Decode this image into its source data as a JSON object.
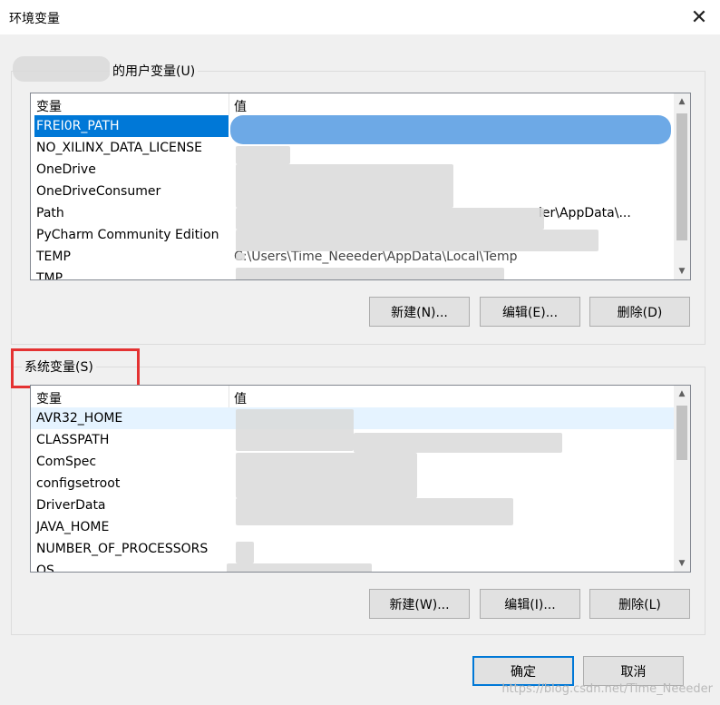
{
  "window": {
    "title": "环境变量",
    "close_icon": "close-icon"
  },
  "user_vars": {
    "group_title": "的用户变量(U)",
    "col_name": "变量",
    "col_value": "值",
    "rows": [
      {
        "name": "FREI0R_PATH",
        "value": ""
      },
      {
        "name": "NO_XILINX_DATA_LICENSE",
        "value": ""
      },
      {
        "name": "OneDrive",
        "value": ""
      },
      {
        "name": "OneDriveConsumer",
        "value": ""
      },
      {
        "name": "Path",
        "value": "ler\\AppData\\..."
      },
      {
        "name": "PyCharm Community Edition",
        "value": ""
      },
      {
        "name": "TEMP",
        "value": "C:\\Users\\Time_Neeeder\\AppData\\Local\\Temp"
      },
      {
        "name": "TMP",
        "value": ""
      }
    ],
    "buttons": {
      "new": "新建(N)...",
      "edit": "编辑(E)...",
      "delete": "删除(D)"
    }
  },
  "system_vars": {
    "group_title": "系统变量(S)",
    "col_name": "变量",
    "col_value": "值",
    "rows": [
      {
        "name": "AVR32_HOME",
        "value": ""
      },
      {
        "name": "CLASSPATH",
        "value": ""
      },
      {
        "name": "ComSpec",
        "value": ""
      },
      {
        "name": "configsetroot",
        "value": ""
      },
      {
        "name": "DriverData",
        "value": ""
      },
      {
        "name": "JAVA_HOME",
        "value": ""
      },
      {
        "name": "NUMBER_OF_PROCESSORS",
        "value": ""
      },
      {
        "name": "OS",
        "value": ""
      }
    ],
    "buttons": {
      "new": "新建(W)...",
      "edit": "编辑(I)...",
      "delete": "删除(L)"
    }
  },
  "footer": {
    "ok": "确定",
    "cancel": "取消"
  },
  "watermark": "https://blog.csdn.net/Time_Neeeder",
  "colors": {
    "selection": "#0078d7",
    "annotation": "#e43232"
  }
}
